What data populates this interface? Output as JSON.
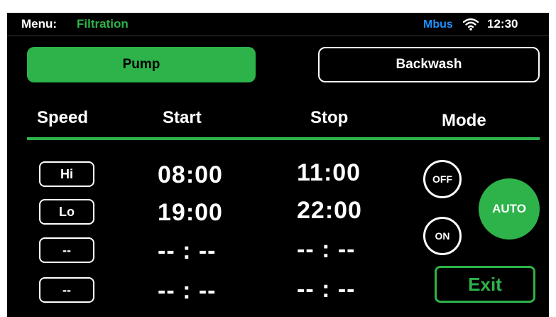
{
  "header": {
    "menu_label": "Menu:",
    "menu_value": "Filtration",
    "bus_label": "Mbus",
    "time": "12:30",
    "wifi_icon": "wifi-icon"
  },
  "tabs": {
    "pump": "Pump",
    "backwash": "Backwash"
  },
  "columns": {
    "speed": "Speed",
    "start": "Start",
    "stop": "Stop",
    "mode": "Mode"
  },
  "schedule": [
    {
      "speed": "Hi",
      "start": "08:00",
      "stop": "11:00"
    },
    {
      "speed": "Lo",
      "start": "19:00",
      "stop": "22:00"
    },
    {
      "speed": "--",
      "start": "-- : --",
      "stop": "-- : --"
    },
    {
      "speed": "--",
      "start": "-- : --",
      "stop": "-- : --"
    }
  ],
  "mode": {
    "off": "OFF",
    "on": "ON",
    "auto": "AUTO",
    "selected": "AUTO"
  },
  "exit_label": "Exit",
  "colors": {
    "accent": "#2db34a",
    "bus": "#1e90ff",
    "background": "#000000"
  }
}
